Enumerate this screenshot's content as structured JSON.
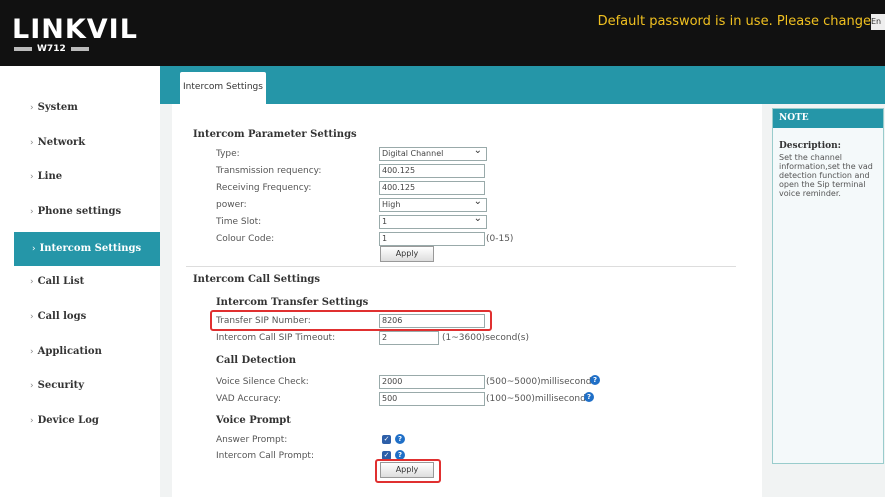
{
  "header": {
    "logo": "LINKVIL",
    "model": "W712",
    "warning": "Default password is in use. Please change",
    "language": "En"
  },
  "sidebar": {
    "items": [
      {
        "label": "System"
      },
      {
        "label": "Network"
      },
      {
        "label": "Line"
      },
      {
        "label": "Phone settings"
      },
      {
        "label": "Intercom Settings",
        "active": true
      },
      {
        "label": "Call List"
      },
      {
        "label": "Call logs"
      },
      {
        "label": "Application"
      },
      {
        "label": "Security"
      },
      {
        "label": "Device Log"
      }
    ]
  },
  "tabs": [
    {
      "label": "Intercom Settings"
    }
  ],
  "parameter_settings": {
    "title": "Intercom Parameter Settings",
    "type": {
      "label": "Type:",
      "value": "Digital Channel"
    },
    "transmission": {
      "label": "Transmission requency:",
      "value": "400.125"
    },
    "receiving": {
      "label": "Receiving Frequency:",
      "value": "400.125"
    },
    "power": {
      "label": "power:",
      "value": "High"
    },
    "time_slot": {
      "label": "Time Slot:",
      "value": "1"
    },
    "colour_code": {
      "label": "Colour Code:",
      "value": "1",
      "hint": "(0-15)"
    },
    "apply": "Apply"
  },
  "call_settings": {
    "title": "Intercom Call Settings",
    "transfer_title": "Intercom Transfer Settings",
    "transfer_sip": {
      "label": "Transfer SIP Number:",
      "value": "8206"
    },
    "sip_timeout": {
      "label": "Intercom Call SIP Timeout:",
      "value": "2",
      "hint": "(1~3600)second(s)"
    },
    "detection_title": "Call Detection",
    "silence_check": {
      "label": "Voice Silence Check:",
      "value": "2000",
      "hint": "(500~5000)millisecond"
    },
    "vad_accuracy": {
      "label": "VAD Accuracy:",
      "value": "500",
      "hint": "(100~500)millisecond"
    },
    "prompt_title": "Voice Prompt",
    "answer_prompt": {
      "label": "Answer Prompt:",
      "checked": true
    },
    "call_prompt": {
      "label": "Intercom Call Prompt:",
      "checked": true
    },
    "apply": "Apply"
  },
  "note": {
    "header": "NOTE",
    "title": "Description:",
    "body": "Set the channel information,set the vad detection function and open the Sip terminal voice reminder."
  },
  "colors": {
    "accent": "#2596a8",
    "header_bg": "#111111",
    "warning": "#f0c020",
    "highlight": "#e03030",
    "help_icon": "#1f6fc7"
  },
  "icons": {
    "help": "help-circle-icon",
    "check": "checkbox-checked-icon",
    "chevron": "chevron-right-icon"
  }
}
